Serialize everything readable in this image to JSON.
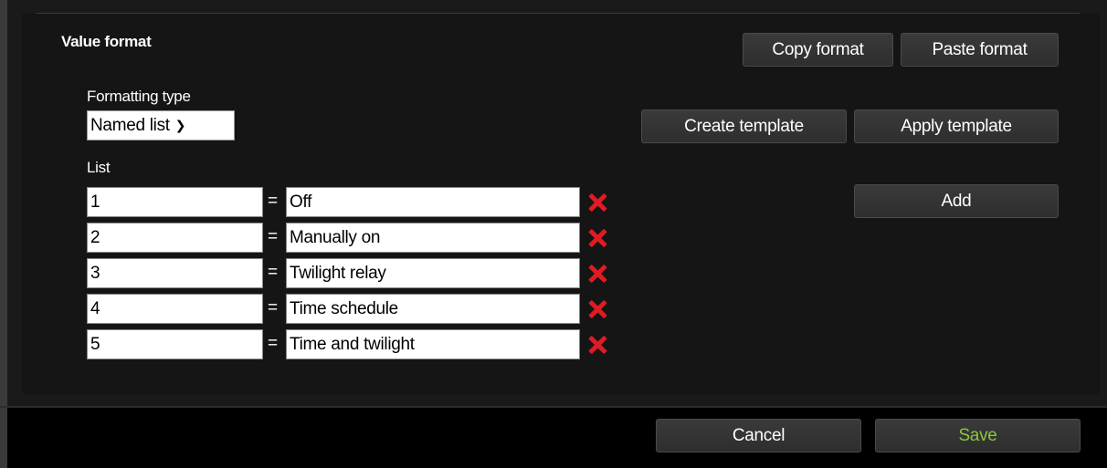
{
  "value_format": {
    "title": "Value format",
    "copy_format_label": "Copy format",
    "paste_format_label": "Paste format",
    "formatting_type_label": "Formatting type",
    "formatting_type_value": "Named list",
    "create_template_label": "Create template",
    "apply_template_label": "Apply template",
    "list_label": "List",
    "add_label": "Add",
    "equals_sign": "=",
    "list_items": [
      {
        "key": "1",
        "value": "Off"
      },
      {
        "key": "2",
        "value": "Manually on"
      },
      {
        "key": "3",
        "value": "Twilight relay"
      },
      {
        "key": "4",
        "value": "Time schedule"
      },
      {
        "key": "5",
        "value": "Time and twilight"
      }
    ]
  },
  "footer": {
    "cancel_label": "Cancel",
    "save_label": "Save"
  },
  "colors": {
    "background": "#000000",
    "panel": "#1a1a1a",
    "delete_icon": "#e01b24",
    "save_text": "#8dc63f"
  },
  "icons": {
    "delete": "delete-x-icon",
    "dropdown": "chevron-down-icon"
  }
}
